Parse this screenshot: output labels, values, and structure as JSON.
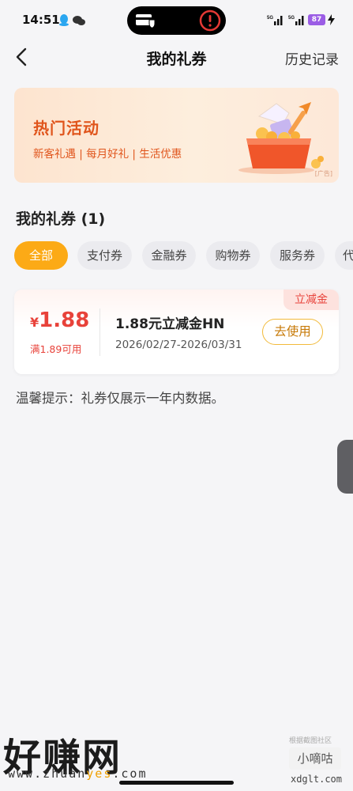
{
  "status_bar": {
    "time": "14:51",
    "battery": "87"
  },
  "nav": {
    "title": "我的礼券",
    "history": "历史记录"
  },
  "banner": {
    "title": "热门活动",
    "subtitle": "新客礼遇 | 每月好礼 | 生活优惠",
    "ad": "[广告]"
  },
  "section": {
    "title": "我的礼券 (1)"
  },
  "chips": [
    "全部",
    "支付券",
    "金融券",
    "购物券",
    "服务券",
    "代"
  ],
  "coupon": {
    "tag": "立减金",
    "currency": "¥",
    "value": "1.88",
    "condition": "满1.89可用",
    "name": "1.88元立减金HN",
    "validity": "2026/02/27-2026/03/31",
    "action": "去使用"
  },
  "tip": "温馨提示：礼券仅展示一年内数据。",
  "watermark": {
    "main": "好赚网",
    "url_pre": "www.zhuan",
    "url_hl": "yes",
    "url_post": ".com"
  },
  "xiaodigu": {
    "caption": "根据截图社区",
    "logo": "小嘀咕"
  },
  "footer_site": "xdglt.com",
  "colors": {
    "accent": "#fcaa16",
    "coupon_red": "#e8423a",
    "banner_orange": "#e0551c"
  }
}
